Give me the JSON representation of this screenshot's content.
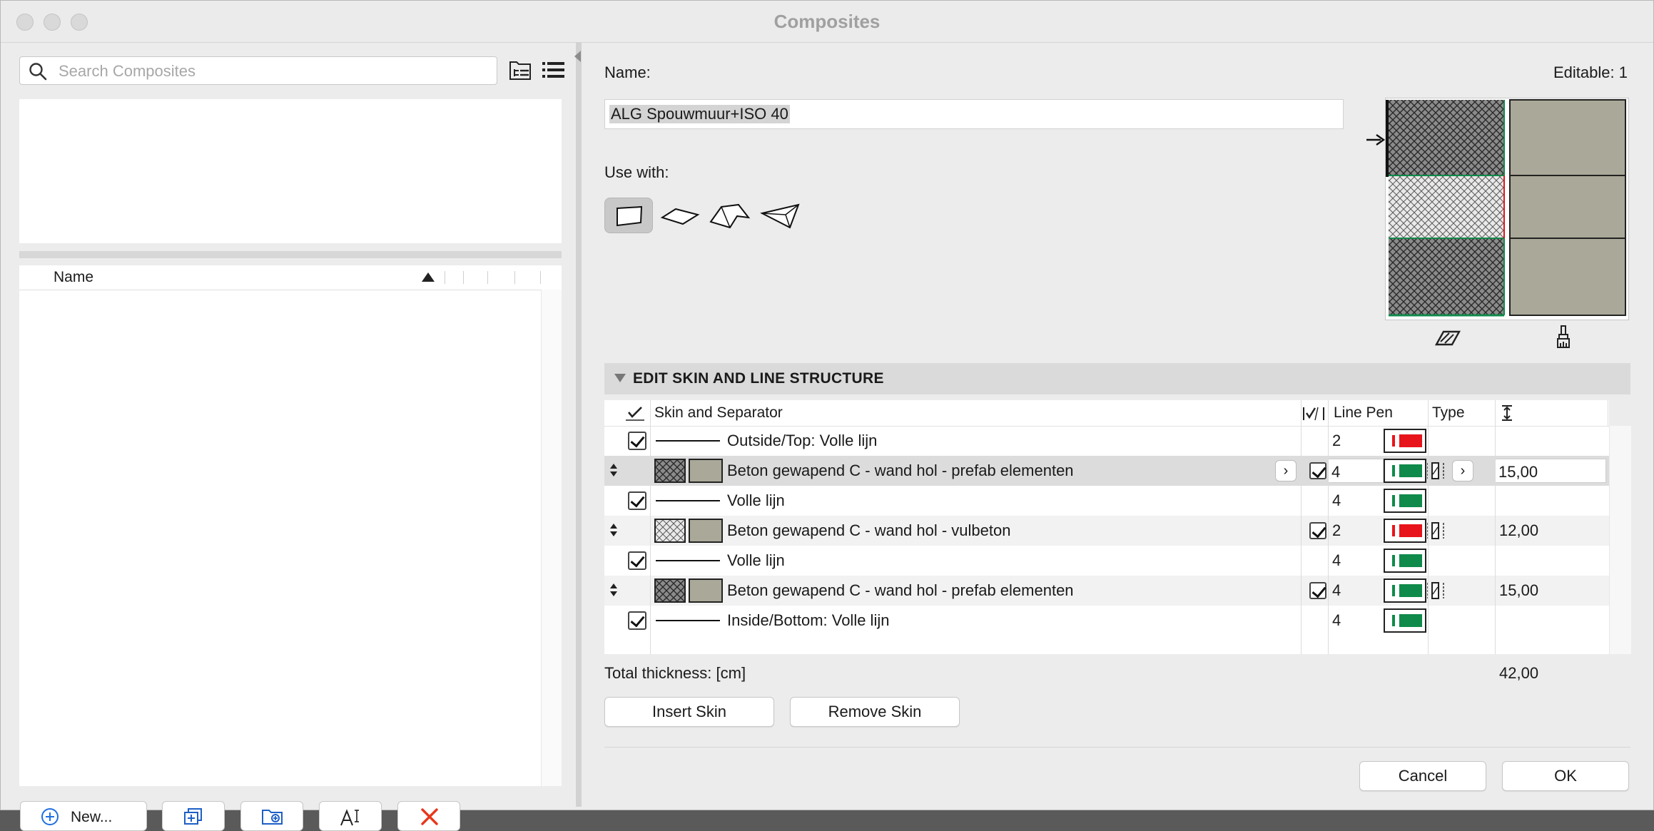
{
  "window": {
    "title": "Composites"
  },
  "left": {
    "search_placeholder": "Search Composites",
    "list_header": "Name",
    "buttons": {
      "new_label": "New..."
    }
  },
  "right": {
    "name_label": "Name:",
    "editable_label": "Editable: 1",
    "name_value": "ALG Spouwmuur+ISO 40",
    "use_with_label": "Use with:",
    "section_title": "EDIT SKIN AND LINE STRUCTURE",
    "columns": {
      "skin": "Skin and Separator",
      "line_pen": "Line Pen",
      "type": "Type"
    },
    "rows": [
      {
        "kind": "line",
        "label": "Outside/Top: Volle lijn",
        "pen": "2",
        "pen_color": "#e8141b"
      },
      {
        "kind": "skin",
        "label": "Beton gewapend C - wand hol - prefab elementen",
        "pen": "4",
        "pen_color": "#0f8a4a",
        "thickness": "15,00",
        "fill": "dense"
      },
      {
        "kind": "line",
        "label": "Volle lijn",
        "pen": "4",
        "pen_color": "#0f8a4a"
      },
      {
        "kind": "skin",
        "label": "Beton gewapend C - wand hol - vulbeton",
        "pen": "2",
        "pen_color": "#e8141b",
        "thickness": "12,00",
        "fill": "light"
      },
      {
        "kind": "line",
        "label": "Volle lijn",
        "pen": "4",
        "pen_color": "#0f8a4a"
      },
      {
        "kind": "skin",
        "label": "Beton gewapend C - wand hol - prefab elementen",
        "pen": "4",
        "pen_color": "#0f8a4a",
        "thickness": "15,00",
        "fill": "dense"
      },
      {
        "kind": "line",
        "label": "Inside/Bottom: Volle lijn",
        "pen": "4",
        "pen_color": "#0f8a4a"
      }
    ],
    "total_label": "Total thickness: [cm]",
    "total_value": "42,00",
    "insert_skin": "Insert Skin",
    "remove_skin": "Remove Skin",
    "cancel": "Cancel",
    "ok": "OK"
  },
  "colors": {
    "pen_red": "#e8141b",
    "pen_green": "#0f8a4a",
    "surface": "#aaa898"
  },
  "icons": [
    "search-icon",
    "folder-tree-icon",
    "list-view-icon",
    "plus-circle-icon",
    "duplicate-icon",
    "new-folder-icon",
    "rename-icon",
    "delete-icon",
    "wall-icon",
    "slab-icon",
    "roof-icon",
    "shell-icon",
    "fill-icon",
    "surface-brush-icon"
  ]
}
